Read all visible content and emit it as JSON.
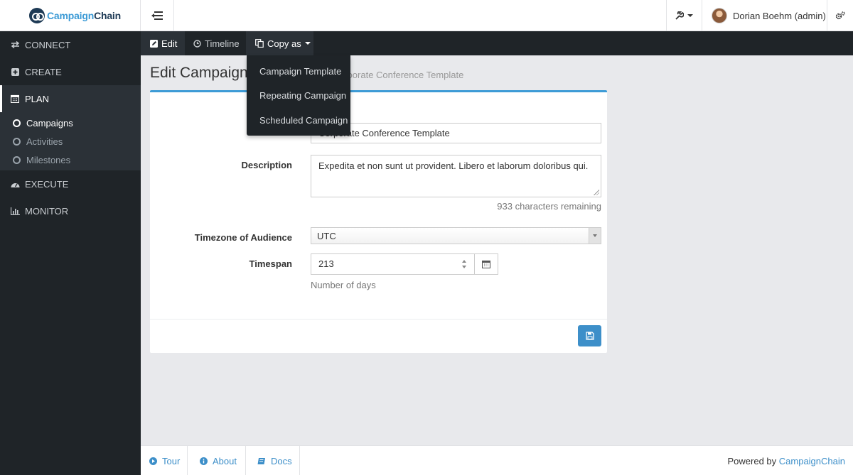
{
  "brand": {
    "part1": "Campaign",
    "part2": "Chain"
  },
  "header": {
    "user_name": "Dorian Boehm (admin)"
  },
  "sidebar": {
    "items": [
      {
        "label": "CONNECT"
      },
      {
        "label": "CREATE"
      },
      {
        "label": "PLAN"
      },
      {
        "label": "EXECUTE"
      },
      {
        "label": "MONITOR"
      }
    ],
    "subitems": [
      {
        "label": "Campaigns"
      },
      {
        "label": "Activities"
      },
      {
        "label": "Milestones"
      }
    ]
  },
  "subbar": {
    "edit": "Edit",
    "timeline": "Timeline",
    "copy_as": "Copy as"
  },
  "dropdown": {
    "items": [
      "Campaign Template",
      "Repeating Campaign",
      "Scheduled Campaign"
    ]
  },
  "page": {
    "title": "Edit Campaign T",
    "subtitle": "orporate Conference Template"
  },
  "form": {
    "name_value": "Corporate Conference Template",
    "description_label": "Description",
    "description_value": "Expedita et non sunt ut provident. Libero et laborum doloribus qui.",
    "chars_remaining": "933 characters remaining",
    "timezone_label": "Timezone of Audience",
    "timezone_value": "UTC",
    "timespan_label": "Timespan",
    "timespan_value": "213",
    "timespan_help": "Number of days"
  },
  "footer": {
    "tour": "Tour",
    "about": "About",
    "docs": "Docs",
    "powered_prefix": "Powered by",
    "powered_link": "CampaignChain"
  },
  "colors": {
    "accent": "#3d9bd6",
    "sidebar_bg": "#1f2428",
    "button": "#3d8fc9"
  }
}
